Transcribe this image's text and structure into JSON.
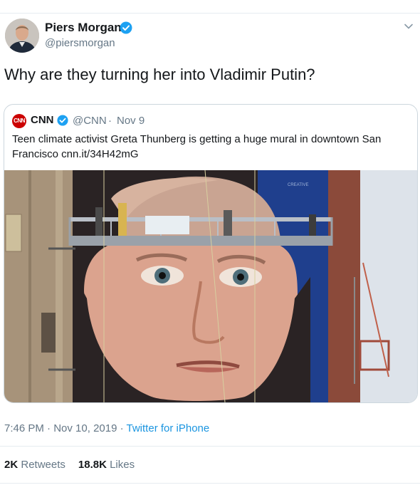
{
  "tweet": {
    "author_name": "Piers Morgan",
    "handle": "@piersmorgan",
    "text": "Why are they turning her into Vladimir Putin?",
    "time": "7:46 PM",
    "date": "Nov 10, 2019",
    "source": "Twitter for iPhone",
    "separator": " · ",
    "retweets_count": "2K",
    "retweets_label": "Retweets",
    "likes_count": "18.8K",
    "likes_label": "Likes",
    "icons": {
      "verified": "verified-badge-icon",
      "menu": "chevron-down-icon"
    }
  },
  "quoted": {
    "logo_text": "CNN",
    "author_name": "CNN",
    "handle": "@CNN",
    "separator": "·",
    "date": "Nov 9",
    "text": "Teen climate activist Greta Thunberg is getting a huge mural in downtown San Francisco cnn.it/34H42mG",
    "image_signage": "CREATIVE"
  },
  "colors": {
    "verified": "#1da1f2",
    "link": "#1b95e0",
    "cnn_red": "#cc0000",
    "secondary_text": "#657786"
  }
}
